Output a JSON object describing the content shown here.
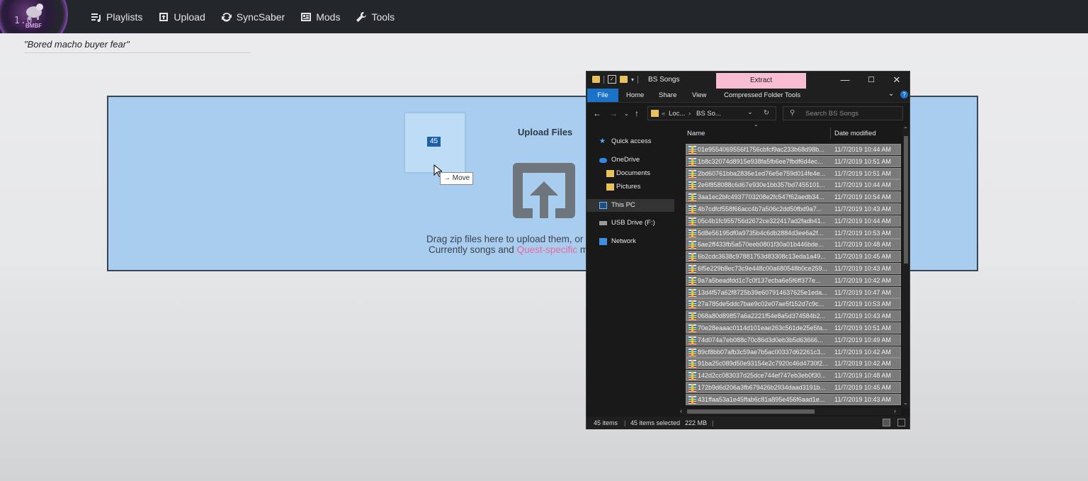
{
  "app": {
    "version_text": "1.0",
    "logo_text": "BMBF"
  },
  "nav": [
    {
      "label": "Playlists",
      "icon": "playlist-icon"
    },
    {
      "label": "Upload",
      "icon": "upload-icon"
    },
    {
      "label": "SyncSaber",
      "icon": "sync-icon"
    },
    {
      "label": "Mods",
      "icon": "mods-icon"
    },
    {
      "label": "Tools",
      "icon": "wrench-icon"
    }
  ],
  "quote": "\"Bored macho buyer fear\"",
  "upload": {
    "title": "Upload Files",
    "drag_line1": "Drag zip files here to upload them, or c",
    "drag_line2_a": "Currently songs and ",
    "drag_line2_link": "Quest-specific",
    "drag_line2_b": " mo",
    "drag_count": "45",
    "drag_tooltip": "Move"
  },
  "colors": {
    "upload_bg": "#a9cdee",
    "nav_bg": "#23272b",
    "link_pink": "#e86aa0",
    "extract_tab": "#f8bcd3",
    "file_tab": "#1a73c8"
  },
  "explorer": {
    "title": "BS Songs",
    "extract_label": "Extract",
    "window_controls": [
      "—",
      "☐",
      "✕"
    ],
    "ribbon_tabs": [
      "File",
      "Home",
      "Share",
      "View",
      "Compressed Folder Tools"
    ],
    "address": {
      "crumb1": "Loc...",
      "crumb2": "BS So...",
      "prefix": "«"
    },
    "search_placeholder": "Search BS Songs",
    "nav_pane": [
      {
        "label": "Quick access",
        "icon": "star-icon"
      },
      {
        "label": "OneDrive",
        "icon": "cloud-icon"
      },
      {
        "label": "Documents",
        "icon": "folder-icon"
      },
      {
        "label": "Pictures",
        "icon": "folder-icon"
      },
      {
        "label": "This PC",
        "icon": "computer-icon"
      },
      {
        "label": "USB Drive (F:)",
        "icon": "drive-icon"
      },
      {
        "label": "Network",
        "icon": "network-icon"
      }
    ],
    "columns": {
      "name": "Name",
      "date": "Date modified"
    },
    "files": [
      {
        "name": "01e9554069556f1756cbfcf9ac233b68d98b...",
        "date": "11/7/2019 10:44 AM"
      },
      {
        "name": "1b8c32074d8915e938fa5fb6ee7fbdf6d4ec...",
        "date": "11/7/2019 10:51 AM"
      },
      {
        "name": "2bd60761bba2836e1ed76e5e759d014fe4e...",
        "date": "11/7/2019 10:51 AM"
      },
      {
        "name": "2e6f858088c6d67e930e1bb357bd7455101...",
        "date": "11/7/2019 10:44 AM"
      },
      {
        "name": "3aa1ec2bfc4937703208e2fc547f62aedb34...",
        "date": "11/7/2019 10:54 AM"
      },
      {
        "name": "4b7cdfcf558f66acc4b7a506c2dd50fbd9a7...",
        "date": "11/7/2019 10:43 AM"
      },
      {
        "name": "05c4b1fc955756d2672ce322417ad2fadb41...",
        "date": "11/7/2019 10:44 AM"
      },
      {
        "name": "5d8e56195df0a9735b4c6db2884d3ee6a2f...",
        "date": "11/7/2019 10:53 AM"
      },
      {
        "name": "6ae2ff433fb5a570eeb0801f30a01b446bde...",
        "date": "11/7/2019 10:48 AM"
      },
      {
        "name": "6b2cdc3638c97881753d83308c13eda1a49...",
        "date": "11/7/2019 10:45 AM"
      },
      {
        "name": "6f5e229b8ec73c9e448c00a680548b0ce259...",
        "date": "11/7/2019 10:43 AM"
      },
      {
        "name": "9a7a5beadfdd1c7c0f137ecba6e5f6ff377e...",
        "date": "11/7/2019 10:42 AM"
      },
      {
        "name": "13d4f57a62f8725b39e607914637625e1eda...",
        "date": "11/7/2019 10:47 AM"
      },
      {
        "name": "27a785de5ddc7bae9c02e07ae5f152d7c9c...",
        "date": "11/7/2019 10:53 AM"
      },
      {
        "name": "068a80d89857a6a2221f54e8a5d374584b2...",
        "date": "11/7/2019 10:43 AM"
      },
      {
        "name": "70e28eaaac0114d101eae263c561de25e5fa...",
        "date": "11/7/2019 10:51 AM"
      },
      {
        "name": "74d074a7eb088c70c86d3d0eb3b5d63666...",
        "date": "11/7/2019 10:49 AM"
      },
      {
        "name": "89cf8bb07afb3c59ae7b5ac00337d62261c3...",
        "date": "11/7/2019 10:42 AM"
      },
      {
        "name": "91ba25c089d50e93154e2c7920c46d4730f2...",
        "date": "11/7/2019 10:42 AM"
      },
      {
        "name": "142d2cc083037d25dce744ef747eb3eb0f30...",
        "date": "11/7/2019 10:48 AM"
      },
      {
        "name": "172b9d6d206a3fb679426b2934daad3191b...",
        "date": "11/7/2019 10:45 AM"
      },
      {
        "name": "431ffaa53a1e45ffab6c81a895e456f6aad1e...",
        "date": "11/7/2019 10:43 AM"
      }
    ],
    "status": {
      "items": "45 items",
      "selected": "45 items selected",
      "size": "222 MB"
    }
  }
}
